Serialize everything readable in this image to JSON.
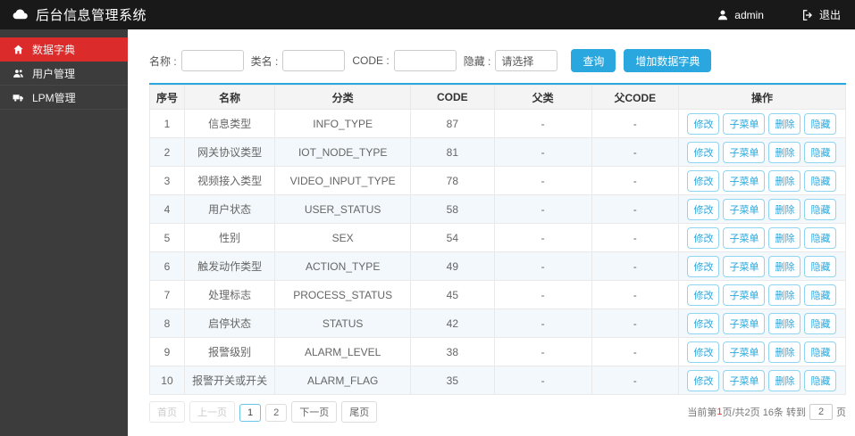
{
  "topbar": {
    "title": "后台信息管理系统",
    "user": "admin",
    "logout": "退出"
  },
  "sidebar": {
    "items": [
      {
        "label": "数据字典",
        "icon": "home",
        "active": true
      },
      {
        "label": "用户管理",
        "icon": "users",
        "active": false
      },
      {
        "label": "LPM管理",
        "icon": "truck",
        "active": false
      }
    ]
  },
  "search": {
    "fields": [
      {
        "key": "name",
        "label": "名称 :",
        "value": "",
        "placeholder": "",
        "type": "input"
      },
      {
        "key": "class-name",
        "label": "类名 :",
        "value": "",
        "placeholder": "",
        "type": "input"
      },
      {
        "key": "code",
        "label": "CODE :",
        "value": "",
        "placeholder": "",
        "type": "input"
      },
      {
        "key": "hidden",
        "label": "隐藏 :",
        "value": "请选择",
        "type": "select"
      }
    ],
    "query_button": "查询",
    "add_button": "增加数据字典"
  },
  "table": {
    "headers": [
      "序号",
      "名称",
      "分类",
      "CODE",
      "父类",
      "父CODE",
      "操作"
    ],
    "header_keys": [
      "index",
      "name",
      "category",
      "code",
      "parent",
      "parent-code",
      "actions"
    ],
    "action_labels": [
      "修改",
      "子菜单",
      "删除",
      "隐藏"
    ],
    "action_keys": [
      "edit",
      "submenu",
      "delete",
      "hide"
    ],
    "rows": [
      {
        "no": "1",
        "name": "信息类型",
        "category": "INFO_TYPE",
        "code": "87",
        "parent": "-",
        "parent_code": "-"
      },
      {
        "no": "2",
        "name": "网关协议类型",
        "category": "IOT_NODE_TYPE",
        "code": "81",
        "parent": "-",
        "parent_code": "-"
      },
      {
        "no": "3",
        "name": "视频接入类型",
        "category": "VIDEO_INPUT_TYPE",
        "code": "78",
        "parent": "-",
        "parent_code": "-"
      },
      {
        "no": "4",
        "name": "用户状态",
        "category": "USER_STATUS",
        "code": "58",
        "parent": "-",
        "parent_code": "-"
      },
      {
        "no": "5",
        "name": "性别",
        "category": "SEX",
        "code": "54",
        "parent": "-",
        "parent_code": "-"
      },
      {
        "no": "6",
        "name": "触发动作类型",
        "category": "ACTION_TYPE",
        "code": "49",
        "parent": "-",
        "parent_code": "-"
      },
      {
        "no": "7",
        "name": "处理标志",
        "category": "PROCESS_STATUS",
        "code": "45",
        "parent": "-",
        "parent_code": "-"
      },
      {
        "no": "8",
        "name": "启停状态",
        "category": "STATUS",
        "code": "42",
        "parent": "-",
        "parent_code": "-"
      },
      {
        "no": "9",
        "name": "报警级别",
        "category": "ALARM_LEVEL",
        "code": "38",
        "parent": "-",
        "parent_code": "-"
      },
      {
        "no": "10",
        "name": "报警开关或开关",
        "category": "ALARM_FLAG",
        "code": "35",
        "parent": "-",
        "parent_code": "-"
      }
    ]
  },
  "pagination": {
    "buttons": [
      {
        "label": "首页",
        "slug": "first",
        "state": "disabled"
      },
      {
        "label": "上一页",
        "slug": "prev",
        "state": "disabled"
      },
      {
        "label": "1",
        "slug": "page-1",
        "state": "active"
      },
      {
        "label": "2",
        "slug": "page-2",
        "state": "normal"
      },
      {
        "label": "下一页",
        "slug": "next",
        "state": "normal"
      },
      {
        "label": "尾页",
        "slug": "last",
        "state": "normal"
      }
    ],
    "summary_prefix": "当前第",
    "current_page": "1",
    "summary_mid": "页/共2页 16条 转到",
    "goto_value": "2",
    "summary_suffix": "页"
  },
  "colors": {
    "topbar_bg": "#191919",
    "sidebar_bg": "#3c3c3c",
    "active_item_red": "#dc2b2b",
    "accent_blue": "#2aa7de",
    "row_stripe": "#f2f8fb",
    "current_page_red": "#e03131"
  }
}
